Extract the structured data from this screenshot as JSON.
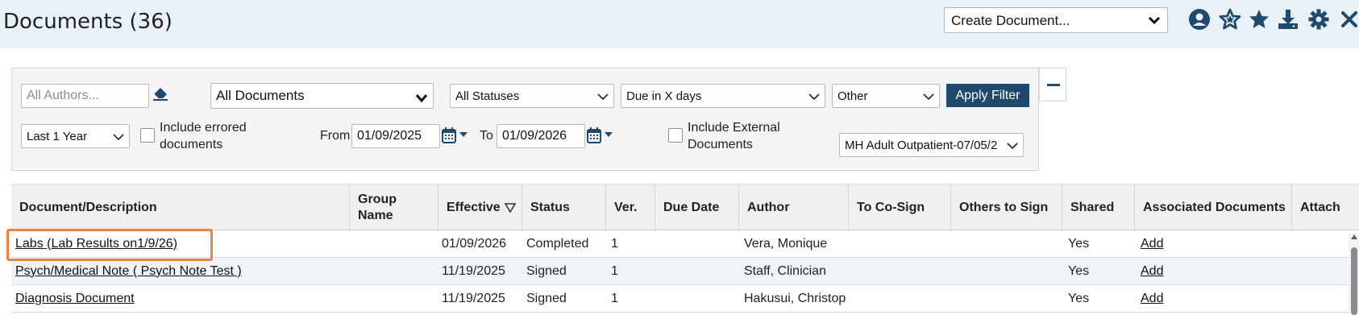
{
  "header": {
    "title": "Documents (36)",
    "create_document": {
      "selected": "Create Document..."
    },
    "icons": [
      "user-circle-icon",
      "star-outline-icon",
      "star-icon",
      "download-icon",
      "gear-icon",
      "close-icon"
    ]
  },
  "filters": {
    "authors": {
      "value": "",
      "placeholder": "All Authors..."
    },
    "document_type": "All Documents",
    "status": "All Statuses",
    "due": "Due in X days",
    "other": "Other",
    "apply_label": "Apply Filter",
    "range": "Last 1 Year",
    "include_errored_label_1": "Include errored",
    "include_errored_label_2": "documents",
    "from_label": "From",
    "from_date": "01/09/2025",
    "to_label": "To",
    "to_date": "01/09/2026",
    "include_external_label_1": "Include External",
    "include_external_label_2": "Documents",
    "program": "MH Adult Outpatient-07/05/2"
  },
  "grid": {
    "columns": {
      "document": "Document/Description",
      "group_1": "Group",
      "group_2": "Name",
      "effective": "Effective",
      "status": "Status",
      "version": "Ver.",
      "due_date": "Due Date",
      "author": "Author",
      "co_sign": "To Co-Sign",
      "others": "Others to Sign",
      "shared": "Shared",
      "associated": "Associated Documents",
      "attach": "Attach"
    },
    "rows": [
      {
        "document": "Labs (Lab Results on1/9/26)",
        "group": "",
        "effective": "01/09/2026",
        "status": "Completed",
        "version": "1",
        "due_date": "",
        "author": "Vera, Monique",
        "co_sign": "",
        "others": "",
        "shared": "Yes",
        "associated": "Add"
      },
      {
        "document": "Psych/Medical Note ( Psych Note Test )",
        "group": "",
        "effective": "11/19/2025",
        "status": "Signed",
        "version": "1",
        "due_date": "",
        "author": "Staff, Clinician",
        "co_sign": "",
        "others": "",
        "shared": "Yes",
        "associated": "Add"
      },
      {
        "document": "Diagnosis Document",
        "group": "",
        "effective": "11/19/2025",
        "status": "Signed",
        "version": "1",
        "due_date": "",
        "author": "Hakusui, Christop",
        "co_sign": "",
        "others": "",
        "shared": "Yes",
        "associated": "Add"
      }
    ]
  },
  "colors": {
    "header_bg": "#e8f0f8",
    "accent": "#1f4a6e",
    "highlight": "#f0813d"
  }
}
